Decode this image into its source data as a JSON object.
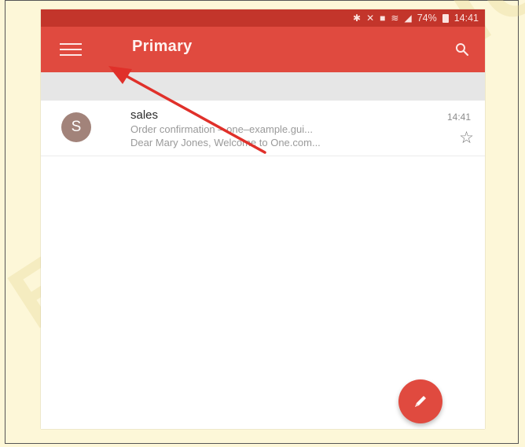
{
  "status_bar": {
    "icons": [
      "bluetooth-icon",
      "mute-icon",
      "nfc-icon",
      "wifi-icon",
      "signal-icon",
      "battery-icon"
    ],
    "battery": "74%",
    "time": "14:41"
  },
  "app_bar": {
    "title": "Primary",
    "menu_icon": "menu-icon",
    "search_icon": "search-icon",
    "color": "#e04a3f"
  },
  "emails": [
    {
      "avatar_letter": "S",
      "sender": "sales",
      "time": "14:41",
      "subject": "Order confirmation – one–example.gui...",
      "snippet": "Dear Mary Jones, Welcome to One.com...",
      "starred": false
    }
  ],
  "compose_button": {
    "icon": "pencil-icon"
  },
  "annotation": {
    "color": "#e0302a"
  },
  "watermark": "EUREPUBLIC"
}
